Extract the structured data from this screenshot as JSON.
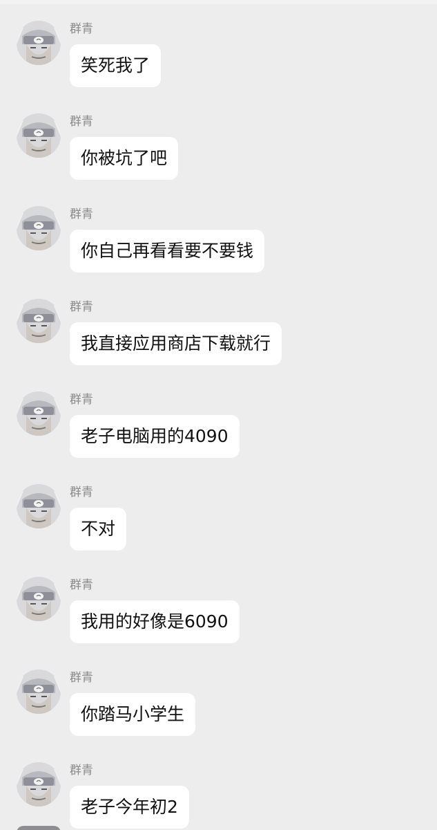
{
  "chat": {
    "messages": [
      {
        "sender": "群青",
        "text": "笑死我了"
      },
      {
        "sender": "群青",
        "text": "你被坑了吧"
      },
      {
        "sender": "群青",
        "text": "你自己再看看要不要钱"
      },
      {
        "sender": "群青",
        "text": "我直接应用商店下载就行"
      },
      {
        "sender": "群青",
        "text": "老子电脑用的4090"
      },
      {
        "sender": "群青",
        "text": "不对"
      },
      {
        "sender": "群青",
        "text": "我用的好像是6090"
      },
      {
        "sender": "群青",
        "text": "你踏马小学生"
      },
      {
        "sender": "群青",
        "text": "老子今年初2"
      }
    ]
  },
  "colors": {
    "background": "#ededed",
    "bubble": "#ffffff",
    "sender_text": "#8a8a8a",
    "message_text": "#111111"
  },
  "icons": {
    "avatar": "ninja-headband-avatar-icon"
  }
}
